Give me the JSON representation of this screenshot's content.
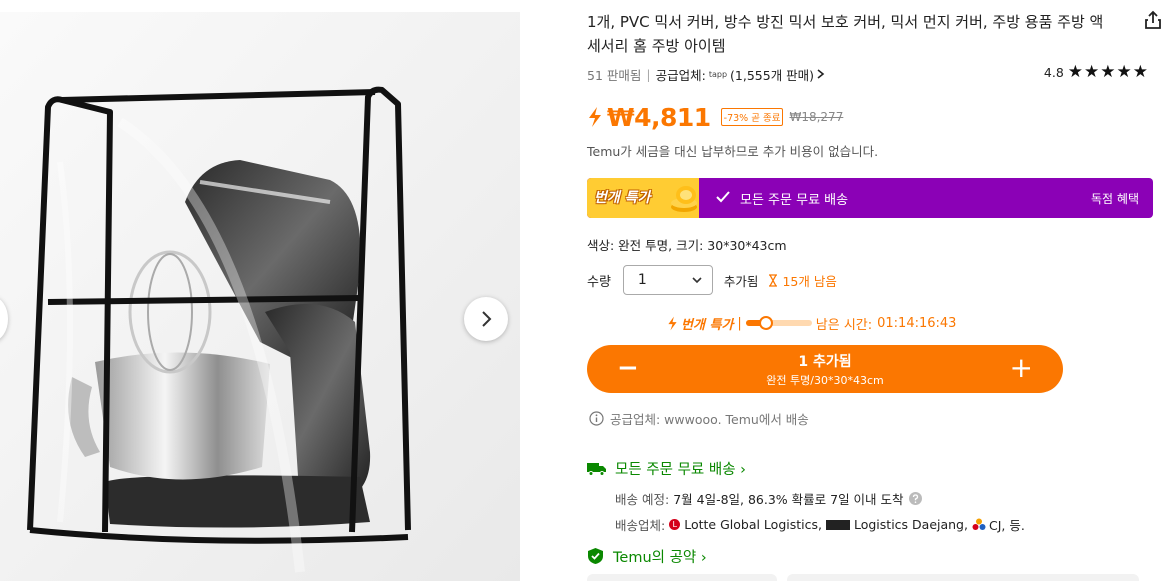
{
  "product": {
    "title": "1개, PVC 믹서 커버, 방수 방진 믹서 보호 커버, 믹서 먼지 커버, 주방 용품 주방 액세서리 홈 주방 아이템",
    "sold": "51 판매됨",
    "separator": "|",
    "supplier_label": "공급업체:",
    "supplier_logo": "tapp",
    "supplier_sales": "(1,555개 판매)",
    "rating_value": "4.8",
    "stars": "★★★★★"
  },
  "price": {
    "current": "₩4,811",
    "discount": "-73% 곧 종료",
    "original": "₩18,277",
    "tax_note": "Temu가 세금을 대신 납부하므로 추가 비용이 없습니다."
  },
  "promo": {
    "tag": "번개 특가",
    "check_text": "모든 주문 무료 배송",
    "exclusive": "독점 혜택",
    "color": "#8b01b6"
  },
  "options": {
    "color_size": "색상: 완전 투명, 크기: 30*30*43cm",
    "qty_label": "수량",
    "qty_value": "1",
    "added": "추가됨",
    "stock": "15개 남음"
  },
  "flash": {
    "label": "번개 특가",
    "separator": "|",
    "progress": 0.3,
    "time_label": "남은 시간:",
    "time_value": "01:14:16:43"
  },
  "cart": {
    "minus": "−",
    "plus": "+",
    "count_label": "1 추가됨",
    "variant": "완전 투명/30*30*43cm"
  },
  "supplier_note": "공급업체: wwwooo. Temu에서 배송",
  "shipping": {
    "headline": "모든 주문 무료 배송 ›",
    "eta_label": "배송 예정:",
    "eta_value": "7월 4일-8일, 86.3% 확률로 7일 이내 도착",
    "carriers_label": "배송업체:",
    "carrier_1": "Lotte Global Logistics,",
    "carrier_2": "Logistics Daejang,",
    "carrier_3": "CJ, 등."
  },
  "promise": "Temu의 공약 ›",
  "colors": {
    "accent": "#fb7701",
    "green": "#0a8800",
    "purple": "#8b01b6"
  },
  "icons": [
    "share-icon",
    "bolt-icon",
    "check-icon",
    "chevron-down-icon",
    "hourglass-icon",
    "info-icon",
    "truck-icon",
    "help-icon",
    "shield-check-icon",
    "chevron-right-icon"
  ]
}
